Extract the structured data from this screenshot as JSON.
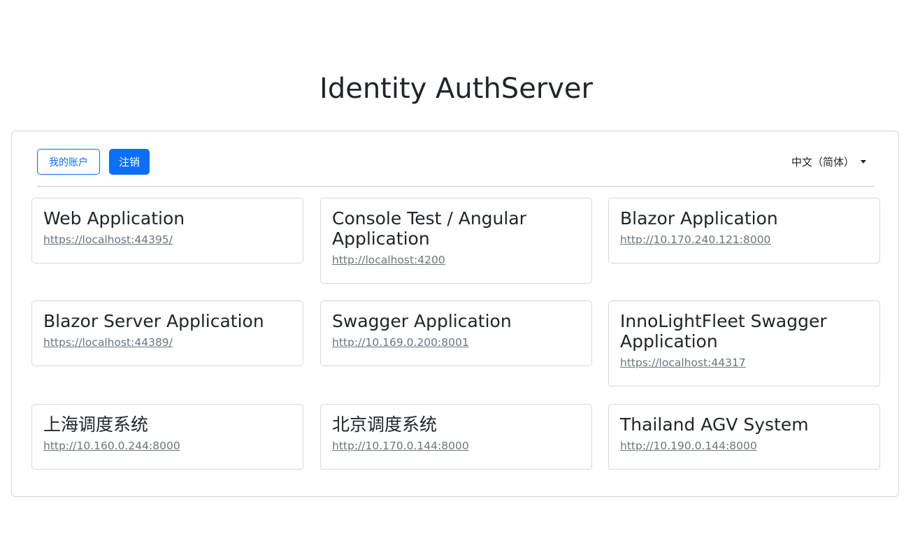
{
  "page": {
    "title": "Identity AuthServer"
  },
  "toolbar": {
    "account_label": "我的账户",
    "logout_label": "注销",
    "language_label": "中文（简体）"
  },
  "applications": [
    {
      "name": "Web Application",
      "url": "https://localhost:44395/"
    },
    {
      "name": "Console Test / Angular Application",
      "url": "http://localhost:4200"
    },
    {
      "name": "Blazor Application",
      "url": "http://10.170.240.121:8000"
    },
    {
      "name": "Blazor Server Application",
      "url": "https://localhost:44389/"
    },
    {
      "name": "Swagger Application",
      "url": "http://10.169.0.200:8001"
    },
    {
      "name": "InnoLightFleet Swagger Application",
      "url": "https://localhost:44317"
    },
    {
      "name": "上海调度系统",
      "url": "http://10.160.0.244:8000"
    },
    {
      "name": "北京调度系统",
      "url": "http://10.170.0.144:8000"
    },
    {
      "name": "Thailand AGV System",
      "url": "http://10.190.0.144:8000"
    }
  ],
  "colors": {
    "primary": "#0d6efd",
    "link": "#6c757d",
    "border": "#d6d8db"
  }
}
